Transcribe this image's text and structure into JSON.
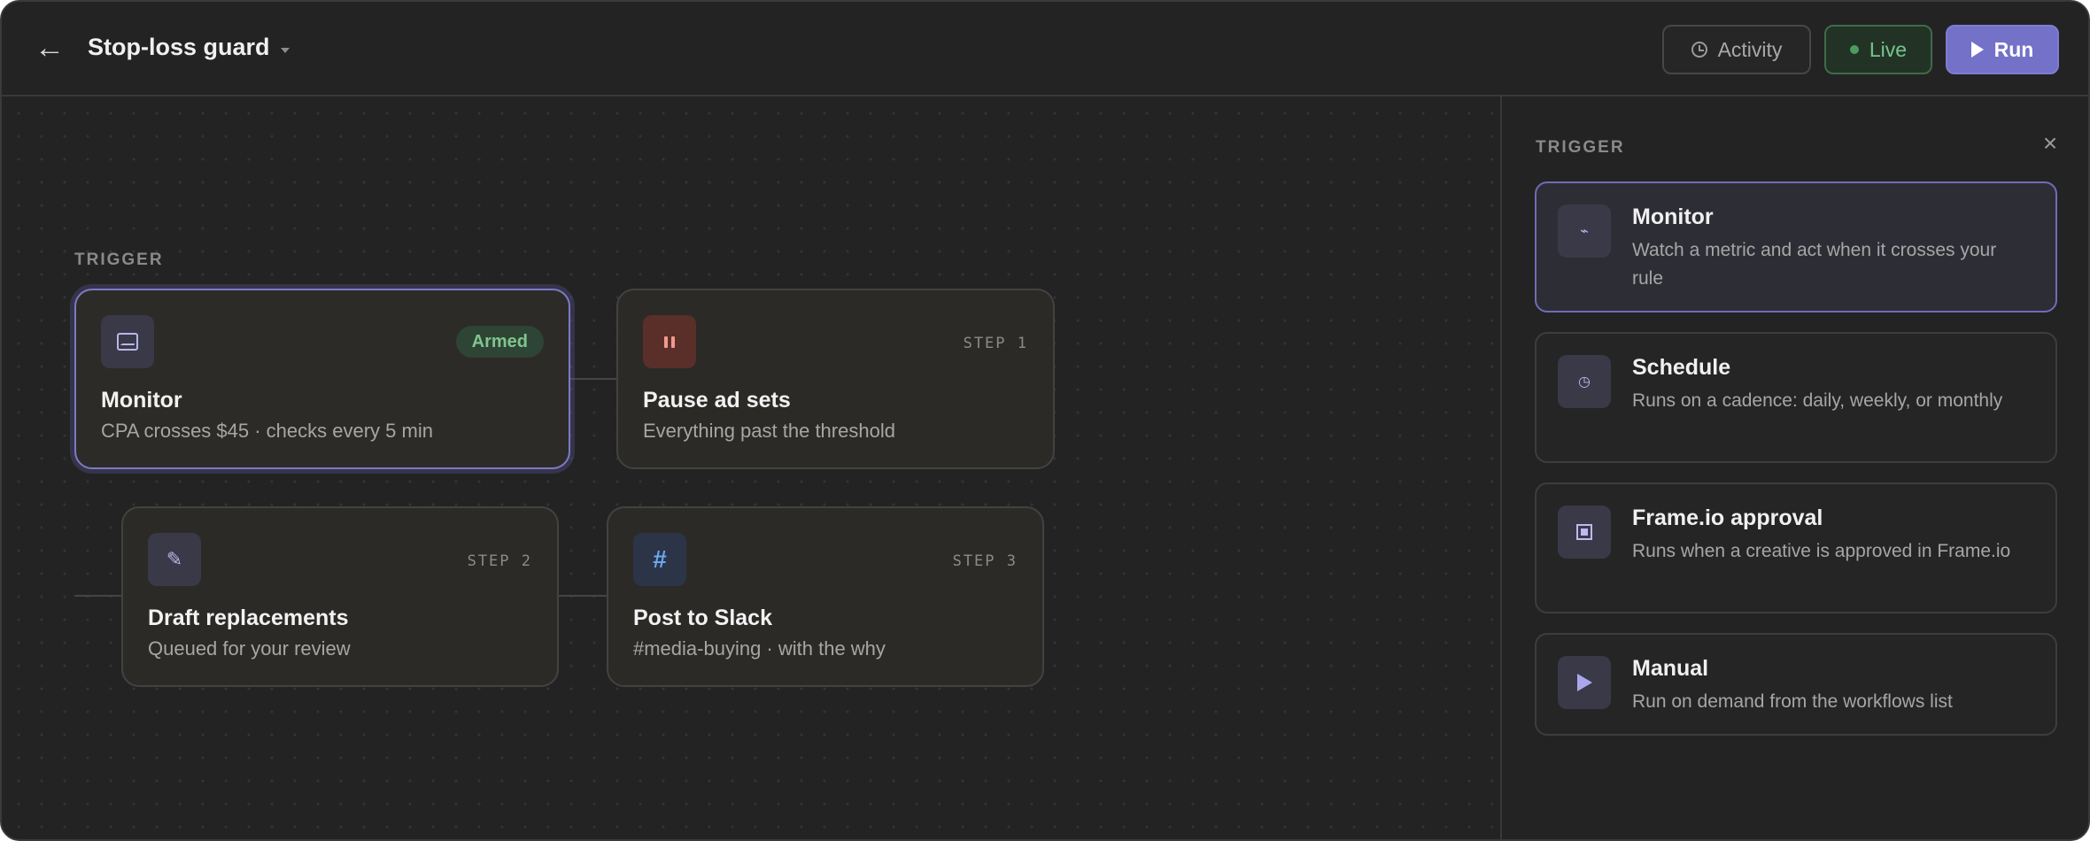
{
  "header": {
    "title": "Stop-loss guard",
    "activity_label": "Activity",
    "live_label": "Live",
    "run_label": "Run"
  },
  "canvas": {
    "trigger_label": "TRIGGER",
    "trigger_node": {
      "title": "Monitor",
      "subtitle": "CPA crosses $45 · checks every 5 min",
      "badge": "Armed"
    },
    "steps": [
      {
        "step": "STEP 1",
        "title": "Pause ad sets",
        "subtitle": "Everything past the threshold"
      },
      {
        "step": "STEP 2",
        "title": "Draft replacements",
        "subtitle": "Queued for your review"
      },
      {
        "step": "STEP 3",
        "title": "Post to Slack",
        "subtitle": "#media-buying · with the why"
      }
    ]
  },
  "panel": {
    "label": "TRIGGER",
    "options": [
      {
        "title": "Monitor",
        "desc": "Watch a metric and act when it crosses your rule",
        "icon": "pulse-icon"
      },
      {
        "title": "Schedule",
        "desc": "Runs on a cadence: daily, weekly, or monthly",
        "icon": "clock-icon"
      },
      {
        "title": "Frame.io approval",
        "desc": "Runs when a creative is approved in Frame.io",
        "icon": "frame-icon"
      },
      {
        "title": "Manual",
        "desc": "Run on demand from the workflows list",
        "icon": "play-icon"
      }
    ]
  },
  "colors": {
    "accent": "#7471c9",
    "live_green": "#78c48d",
    "background": "#232323"
  }
}
